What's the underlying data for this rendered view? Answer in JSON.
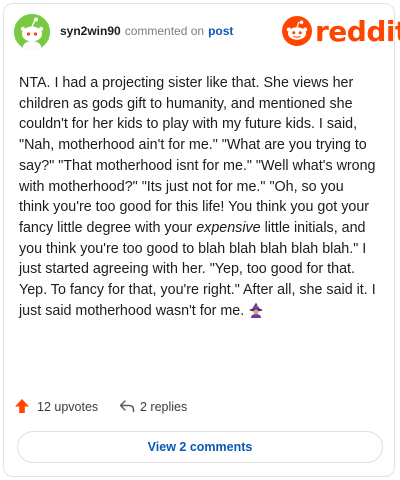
{
  "comment": {
    "username": "syn2win90",
    "action": "commented on",
    "target_link": "post",
    "brand": "reddit",
    "body_before_italic": "NTA. I had a projecting sister like that. She views her children as gods gift to humanity, and mentioned she couldn't for her kids to play with my future kids. I said, \"Nah, motherhood ain't for me.\" \"What are you trying to say?\" \"That motherhood isnt for me.\" \"Well what's wrong with motherhood?\" \"Its just not for me.\" \"Oh, so you think you're too good for this life! You think you got your fancy little degree with your ",
    "body_italic": "expensive",
    "body_after_italic": " little initials, and you think you're too good to blah blah blah blah blah.\" I just started agreeing with her. \"Yep, too good for that. Yep. To fancy for that, you're right.\" After all, she said it. I just said motherhood wasn't for me. ",
    "emoji_icon": "woman-mage-emoji-icon"
  },
  "footer": {
    "upvotes": "12 upvotes",
    "replies": "2 replies",
    "view_comments": "View 2 comments"
  },
  "colors": {
    "brand": "#ff4500",
    "link": "#0b57b7",
    "avatar": "#7ac943"
  }
}
